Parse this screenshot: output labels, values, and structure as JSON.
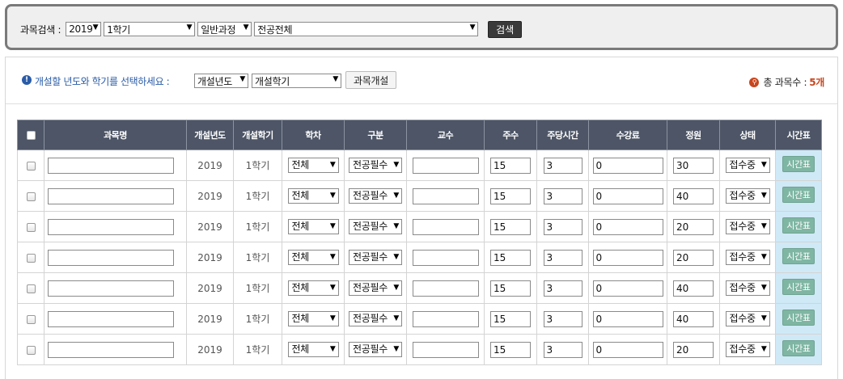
{
  "search": {
    "label": "과목검색 :",
    "year": "2019",
    "semester": "1학기",
    "course_type": "일반과정",
    "major": "전공전체",
    "button": "검색"
  },
  "toolbar": {
    "info_text": "개설할 년도와 학기를 선택하세요 :",
    "year_select": "개설년도",
    "semester_select": "개설학기",
    "open_button": "과목개설",
    "total_label": "총 과목수 :",
    "total_count": "5개"
  },
  "table": {
    "headers": [
      "과목명",
      "개설년도",
      "개설학기",
      "학차",
      "구분",
      "교수",
      "주수",
      "주당시간",
      "수강료",
      "정원",
      "상태",
      "시간표"
    ],
    "rows": [
      {
        "name": "",
        "year": "2019",
        "semester": "1학기",
        "term": "전체",
        "category": "전공필수",
        "professor": "",
        "weeks": "15",
        "hours": "3",
        "fee": "0",
        "capacity": "30",
        "status": "접수중",
        "timetable": "시간표"
      },
      {
        "name": "",
        "year": "2019",
        "semester": "1학기",
        "term": "전체",
        "category": "전공필수",
        "professor": "",
        "weeks": "15",
        "hours": "3",
        "fee": "0",
        "capacity": "40",
        "status": "접수중",
        "timetable": "시간표"
      },
      {
        "name": "",
        "year": "2019",
        "semester": "1학기",
        "term": "전체",
        "category": "전공필수",
        "professor": "",
        "weeks": "15",
        "hours": "3",
        "fee": "0",
        "capacity": "20",
        "status": "접수중",
        "timetable": "시간표"
      },
      {
        "name": "",
        "year": "2019",
        "semester": "1학기",
        "term": "전체",
        "category": "전공필수",
        "professor": "",
        "weeks": "15",
        "hours": "3",
        "fee": "0",
        "capacity": "20",
        "status": "접수중",
        "timetable": "시간표"
      },
      {
        "name": "",
        "year": "2019",
        "semester": "1학기",
        "term": "전체",
        "category": "전공필수",
        "professor": "",
        "weeks": "15",
        "hours": "3",
        "fee": "0",
        "capacity": "40",
        "status": "접수중",
        "timetable": "시간표"
      },
      {
        "name": "",
        "year": "2019",
        "semester": "1학기",
        "term": "전체",
        "category": "전공필수",
        "professor": "",
        "weeks": "15",
        "hours": "3",
        "fee": "0",
        "capacity": "40",
        "status": "접수중",
        "timetable": "시간표"
      },
      {
        "name": "",
        "year": "2019",
        "semester": "1학기",
        "term": "전체",
        "category": "전공필수",
        "professor": "",
        "weeks": "15",
        "hours": "3",
        "fee": "0",
        "capacity": "20",
        "status": "접수중",
        "timetable": "시간표"
      }
    ]
  },
  "icons": {
    "dropdown": "chevron-down-icon",
    "info": "info-icon",
    "total": "search-magnifier-icon"
  },
  "colors": {
    "header_bg": "#4d5566",
    "info_text": "#2a5ca8",
    "total_count": "#c8461d",
    "timetable_bg": "#cfe9f7",
    "timetable_button": "#7fb6a3"
  }
}
